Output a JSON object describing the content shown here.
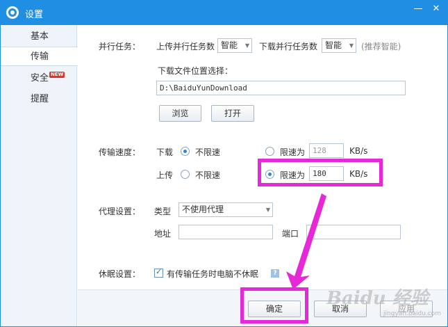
{
  "window": {
    "title": "设置",
    "accent_color": "#1e8fe2",
    "icon": "gear-icon",
    "minimize_symbol": "—",
    "close_symbol": "✕"
  },
  "sidebar": {
    "items": [
      {
        "label": "基本"
      },
      {
        "label": "传输",
        "active": true
      },
      {
        "label": "安全",
        "badge": "NEW"
      },
      {
        "label": "提醒"
      }
    ]
  },
  "parallel": {
    "section_label": "并行任务：",
    "upload_label": "上传并行任务数",
    "upload_value": "智能",
    "download_label": "下载并行任务数",
    "download_value": "智能",
    "hint": "(推荐智能)"
  },
  "download_location": {
    "label": "下载文件位置选择：",
    "path": "D:\\BaiduYunDownload",
    "browse_label": "浏览",
    "open_label": "打开"
  },
  "speed": {
    "section_label": "传输速度：",
    "download_label": "下载",
    "download_unlimited_label": "不限速",
    "download_limit_label": "限速为",
    "download_limit_value": "128",
    "download_selected": "unlimited",
    "upload_label": "上传",
    "upload_unlimited_label": "不限速",
    "upload_limit_label": "限速为",
    "upload_limit_value": "180",
    "upload_selected": "limit",
    "unit": "KB/s"
  },
  "proxy": {
    "section_label": "代理设置：",
    "type_label": "类型",
    "type_value": "不使用代理",
    "address_label": "地址",
    "address_value": "",
    "port_label": "端口",
    "port_value": ""
  },
  "sleep": {
    "section_label": "休眠设置：",
    "checkbox_label": "有传输任务时电脑不休眠",
    "checked": true,
    "help_symbol": "?"
  },
  "footer": {
    "ok_label": "确定",
    "cancel_label": "取消",
    "apply_label": "应用"
  },
  "annotation": {
    "highlight_color": "#e629d8"
  },
  "watermark": {
    "main": "Baidu 经验",
    "sub": "jingyan.baidu.com"
  }
}
